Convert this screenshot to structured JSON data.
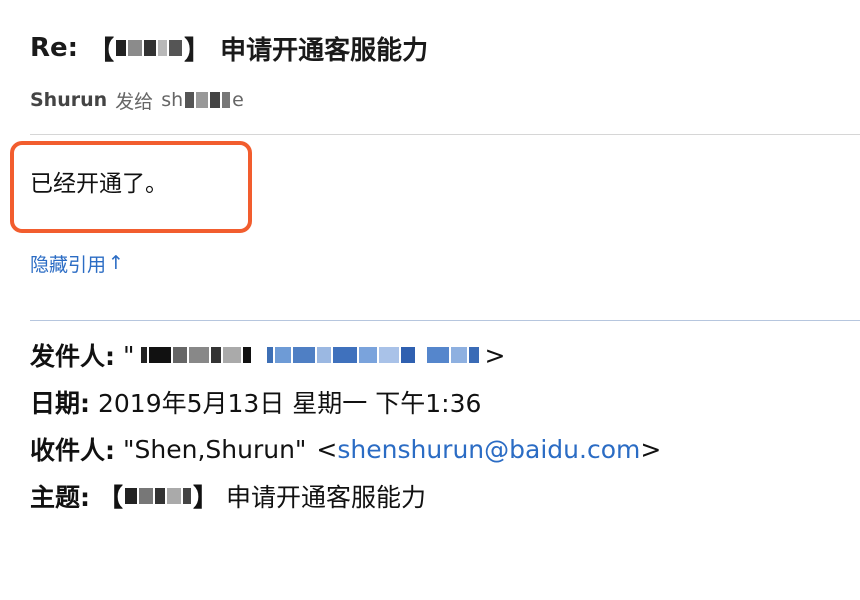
{
  "email": {
    "subject_prefix": "Re:",
    "subject_text": "申请开通客服能力",
    "subject_bracket_open": "【",
    "subject_bracket_close": "】",
    "sender_name": "Shurun",
    "sender_verb": "发给",
    "recipient_visible_prefix": "sh",
    "recipient_visible_suffix": "e",
    "body": "已经开通了。",
    "toggle_quote_label": "隐藏引用",
    "toggle_quote_arrow": "↑",
    "quoted": {
      "from_label": "发件人:",
      "from_value_open": "\"",
      "from_value_close": ">",
      "date_label": "日期:",
      "date_value": "2019年5月13日 星期一 下午1:36",
      "to_label": "收件人:",
      "to_name": "\"Shen,Shurun\"",
      "to_email_open": "<",
      "to_email": "shenshurun@baidu.com",
      "to_email_close": ">",
      "subject_label": "主题:",
      "subject_bracket_open": "【",
      "subject_bracket_close": "】",
      "subject_text": "申请开通客服能力"
    }
  },
  "colors": {
    "link": "#2b6cc4",
    "highlight_border": "#f25d2e",
    "divider": "#d6d6d6",
    "quote_divider": "#b6c6de"
  }
}
